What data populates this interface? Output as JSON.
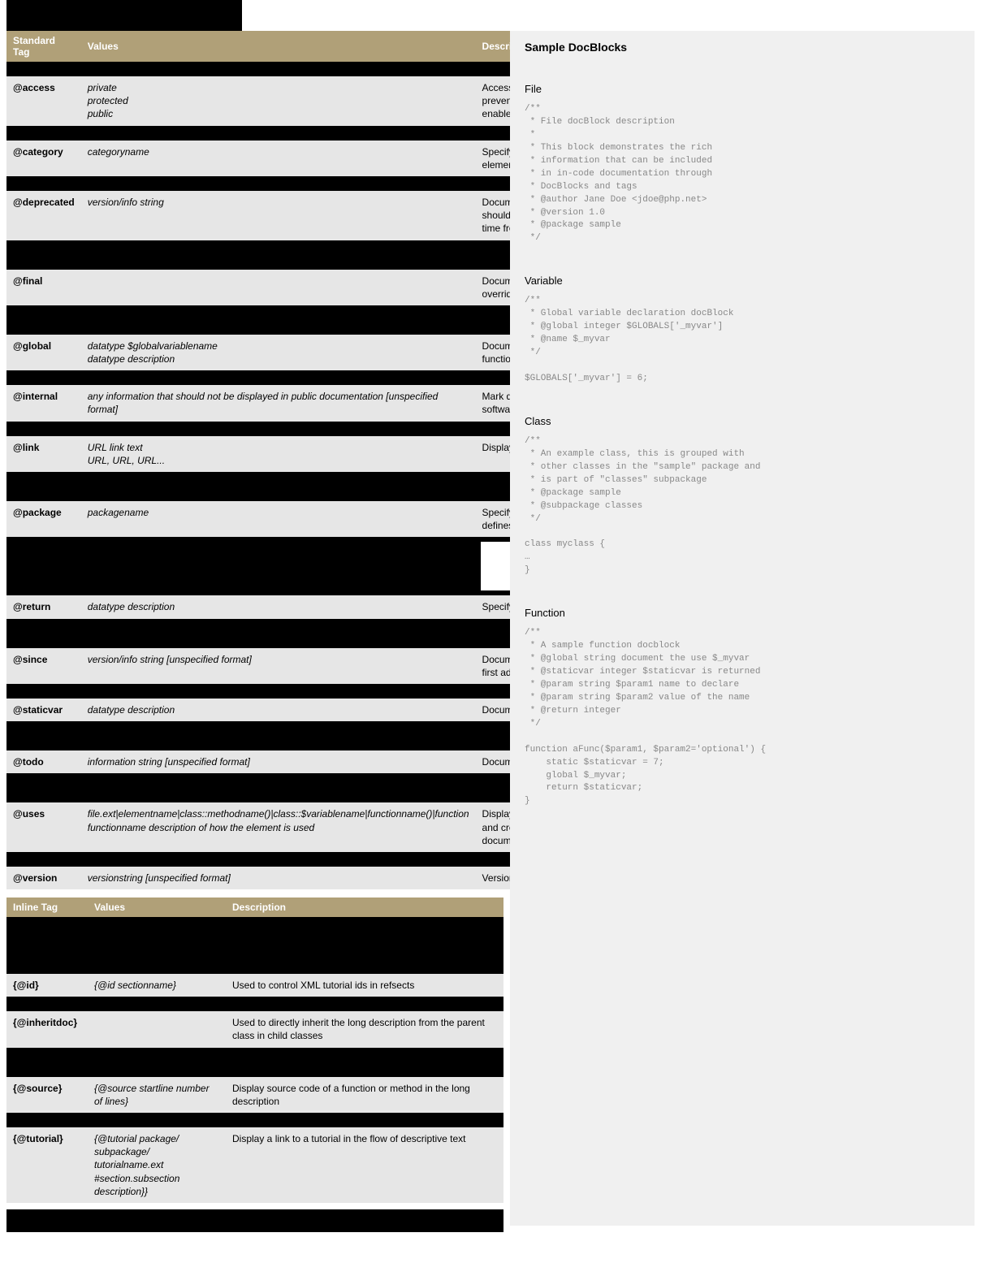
{
  "table1": {
    "headers": [
      "Standard Tag",
      "Values",
      "Description"
    ],
    "rows": [
      {
        "type": "blackrow"
      },
      {
        "tag": "@access",
        "values": "private\nprotected\npublic",
        "desc": "Access control for an element. @access private prevents documentation of the following element (if enabled)."
      },
      {
        "type": "blackrow"
      },
      {
        "tag": "@category",
        "values": "categoryname",
        "desc": "Specify a category to organize the documented element's package into"
      },
      {
        "type": "blackrow"
      },
      {
        "tag": "@deprecated",
        "values": "version/info string",
        "desc": "Document elements that have been deprecated and should not be used as they may be removed at any time from a future version"
      },
      {
        "type": "blackrow-tall"
      },
      {
        "tag": "@final",
        "values": "",
        "desc": "Document a class method that should never be overridden in a child class"
      },
      {
        "type": "blackrow-tall"
      },
      {
        "tag": "@global",
        "values": "datatype  $globalvariablename\ndatatype description",
        "desc": "Document a global variable, or its use in a function/method"
      },
      {
        "type": "blackrow"
      },
      {
        "tag": "@internal",
        "values": "any information that should not be displayed in public documentation [unspecified format]",
        "desc": "Mark documentation as private, internal to the software project"
      },
      {
        "type": "blackrow"
      },
      {
        "tag": "@link",
        "values": "URL  link text\nURL, URL, URL...",
        "desc": "Display a hyperlink to a URL in the documentation"
      },
      {
        "type": "blackrow-tall"
      },
      {
        "tag": "@package",
        "values": "packagename",
        "desc": "Specify package to group classes or functions and defines into"
      },
      {
        "type": "whitebox"
      },
      {
        "tag": "@return",
        "values": "datatype  description",
        "desc": "Specify the return type of a function or method"
      },
      {
        "type": "blackrow-tall"
      },
      {
        "tag": "@since",
        "values": "version/info string [unspecified format]",
        "desc": "Document when (at which version) an element was first added to a package"
      },
      {
        "type": "blackrow"
      },
      {
        "tag": "@staticvar",
        "values": "datatype  description",
        "desc": "Document a static variable's use in a function/method"
      },
      {
        "type": "blackrow-tall"
      },
      {
        "tag": "@todo",
        "values": "information string [unspecified format]",
        "desc": "Document changes that will be made in the future"
      },
      {
        "type": "blackrow-tall"
      },
      {
        "tag": "@uses",
        "values": "file.ext|elementname|class::methodname()|class::$variablename|functionname()|function functionname  description of how the element is used",
        "desc": "Display a link to the documentation for an element, and create a backlink in the other element's documentation to this"
      },
      {
        "type": "blackrow"
      },
      {
        "tag": "@version",
        "values": "versionstring [unspecified format]",
        "desc": "Version of current element"
      }
    ]
  },
  "table2": {
    "headers": [
      "Inline Tag",
      "Values",
      "Description"
    ],
    "rows": [
      {
        "type": "blackrow-tall2"
      },
      {
        "tag": "{@id}",
        "values": "{@id  sectionname}",
        "desc": "Used to control XML tutorial ids in refsects"
      },
      {
        "type": "blackrow"
      },
      {
        "tag": "{@inheritdoc}",
        "values": "",
        "desc": "Used to directly inherit the long description from the parent class in child classes"
      },
      {
        "type": "blackrow-tall"
      },
      {
        "tag": "{@source}",
        "values": "{@source  startline number of lines}",
        "desc": "Display source code of a function or method in the long description"
      },
      {
        "type": "blackrow"
      },
      {
        "tag": "{@tutorial}",
        "values": "{@tutorial  package/  subpackage/ tutorialname.ext  #section.subsection description}}",
        "desc": "Display a link to a tutorial in the flow of descriptive text"
      }
    ]
  },
  "samples": {
    "title": "Sample DocBlocks",
    "sections": [
      {
        "heading": "File",
        "code": "/**\n * File docBlock description\n *\n * This block demonstrates the rich\n * information that can be included\n * in in-code documentation through\n * DocBlocks and tags\n * @author Jane Doe <jdoe@php.net>\n * @version 1.0\n * @package sample\n */"
      },
      {
        "heading": "Variable",
        "code": "/**\n * Global variable declaration docBlock\n * @global integer $GLOBALS['_myvar']\n * @name $_myvar\n */\n\n$GLOBALS['_myvar'] = 6;"
      },
      {
        "heading": "Class",
        "code": "/**\n * An example class, this is grouped with\n * other classes in the \"sample\" package and\n * is part of \"classes\" subpackage\n * @package sample\n * @subpackage classes\n */\n\nclass myclass {\n…\n}"
      },
      {
        "heading": "Function",
        "code": "/**\n * A sample function docblock\n * @global string document the use $_myvar\n * @staticvar integer $staticvar is returned\n * @param string $param1 name to declare\n * @param string $param2 value of the name\n * @return integer\n */\n\nfunction aFunc($param1, $param2='optional') {\n    static $staticvar = 7;\n    global $_myvar;\n    return $staticvar;\n}"
      }
    ]
  }
}
